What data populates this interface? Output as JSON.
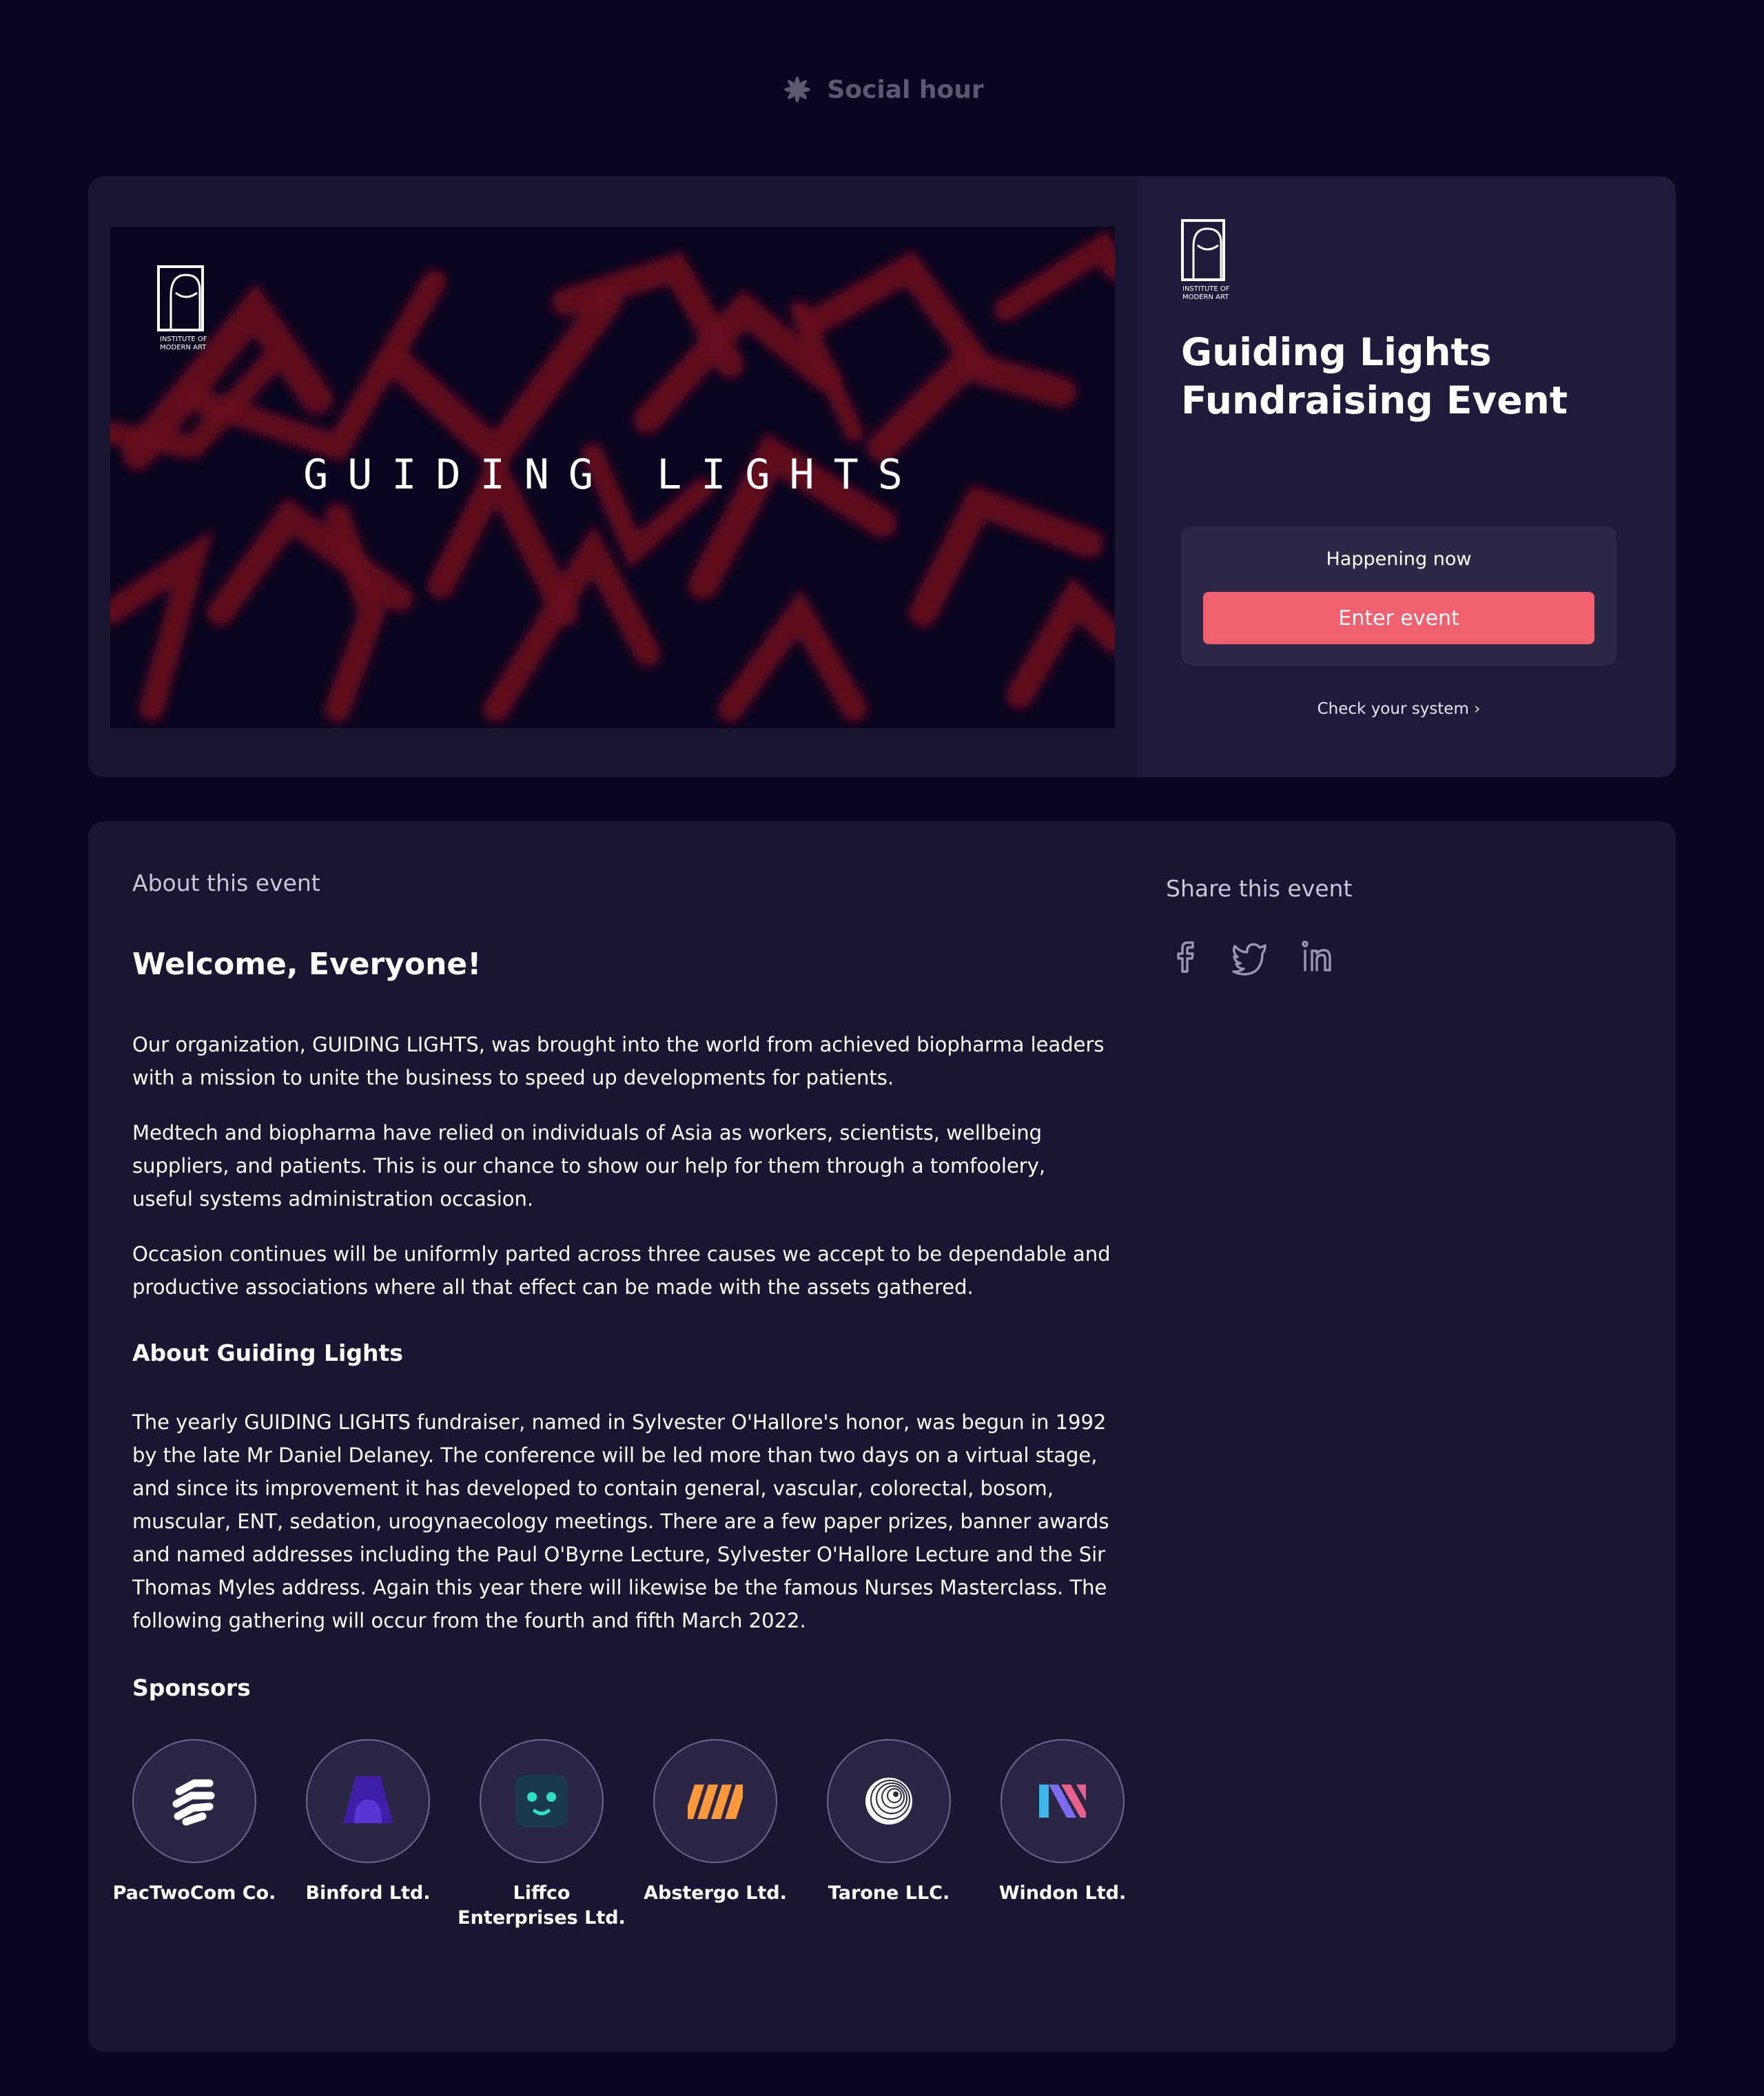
{
  "header": {
    "brand_name": "Social hour",
    "brand_icon": "asterisk-flower-icon"
  },
  "hero": {
    "banner_title": "GUIDING LIGHTS",
    "banner_logo_text": [
      "INSTITUTE OF",
      "MODERN ART"
    ],
    "logo_text": [
      "INSTITUTE OF",
      "MODERN ART"
    ],
    "event_title": "Guiding Lights Fundraising Event",
    "status_label": "Happening now",
    "enter_button": "Enter event",
    "check_system": "Check your system ›",
    "colors": {
      "accent": "#f0606e",
      "banner_red": "#c5141c"
    }
  },
  "about": {
    "heading": "About this event",
    "welcome": "Welcome, Everyone!",
    "paragraphs": [
      "Our organization, GUIDING LIGHTS, was brought into the world from achieved biopharma leaders with a mission to unite the business to speed up developments for patients.",
      "Medtech and biopharma have relied on individuals of Asia as workers, scientists, wellbeing suppliers, and patients. This is our chance to show our help for them through a tomfoolery, useful systems administration occasion.",
      "Occasion continues will be uniformly parted across three causes we accept to be dependable and productive associations where all that effect can be made with the assets gathered."
    ],
    "guiding_heading": "About Guiding Lights",
    "guiding_paragraph": "The yearly GUIDING LIGHTS fundraiser, named in Sylvester O'Hallore's honor, was begun in 1992 by the late Mr Daniel Delaney. The conference will be led more than two days on a virtual stage, and since its improvement it has developed to contain general, vascular, colorectal, bosom, muscular, ENT, sedation, urogynaecology meetings. There are a few paper prizes, banner awards and named addresses including the Paul O'Byrne Lecture, Sylvester O'Hallore Lecture and the Sir Thomas Myles address. Again this year there will likewise be the famous Nurses Masterclass. The following gathering will occur from the fourth and fifth March 2022.",
    "sponsors_heading": "Sponsors",
    "sponsors": [
      {
        "name": "PacTwoCom Co.",
        "icon": "pactwocom-logo-icon"
      },
      {
        "name": "Binford Ltd.",
        "icon": "binford-logo-icon"
      },
      {
        "name": "Liffco Enterprises Ltd.",
        "icon": "liffco-logo-icon"
      },
      {
        "name": "Abstergo Ltd.",
        "icon": "abstergo-logo-icon"
      },
      {
        "name": "Tarone LLC.",
        "icon": "tarone-logo-icon"
      },
      {
        "name": "Windon Ltd.",
        "icon": "windon-logo-icon"
      }
    ]
  },
  "share": {
    "heading": "Share this event",
    "icons": [
      "facebook-icon",
      "twitter-icon",
      "linkedin-icon"
    ]
  }
}
